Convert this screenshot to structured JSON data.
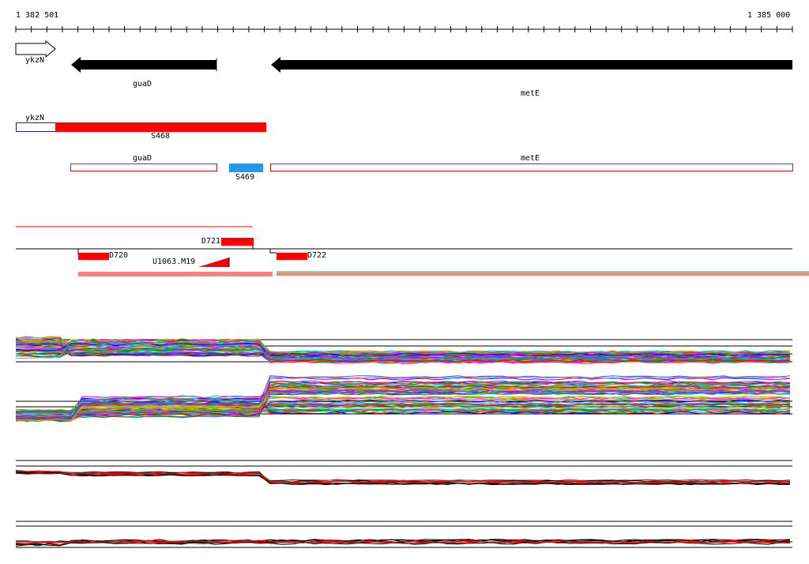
{
  "ruler": {
    "start_label": "1 382 501",
    "end_label": "1 385 000"
  },
  "genes": {
    "ykzN": "ykzN",
    "guaD": "guaD",
    "metE": "metE"
  },
  "transcripts": {
    "ykzN": "ykzN",
    "S468": "S468",
    "guaD": "guaD",
    "S469": "S469",
    "metE": "metE"
  },
  "features": {
    "D721": "D721",
    "D720": "D720",
    "D722": "D722",
    "U1063": "U1063.M19"
  },
  "colors": {
    "gene_arrow": "#000000",
    "segment_red": "#ff0000",
    "segment_blue": "#1e9bef",
    "outline_red": "#d21414",
    "outline_blue": "#1e1ea0"
  }
}
